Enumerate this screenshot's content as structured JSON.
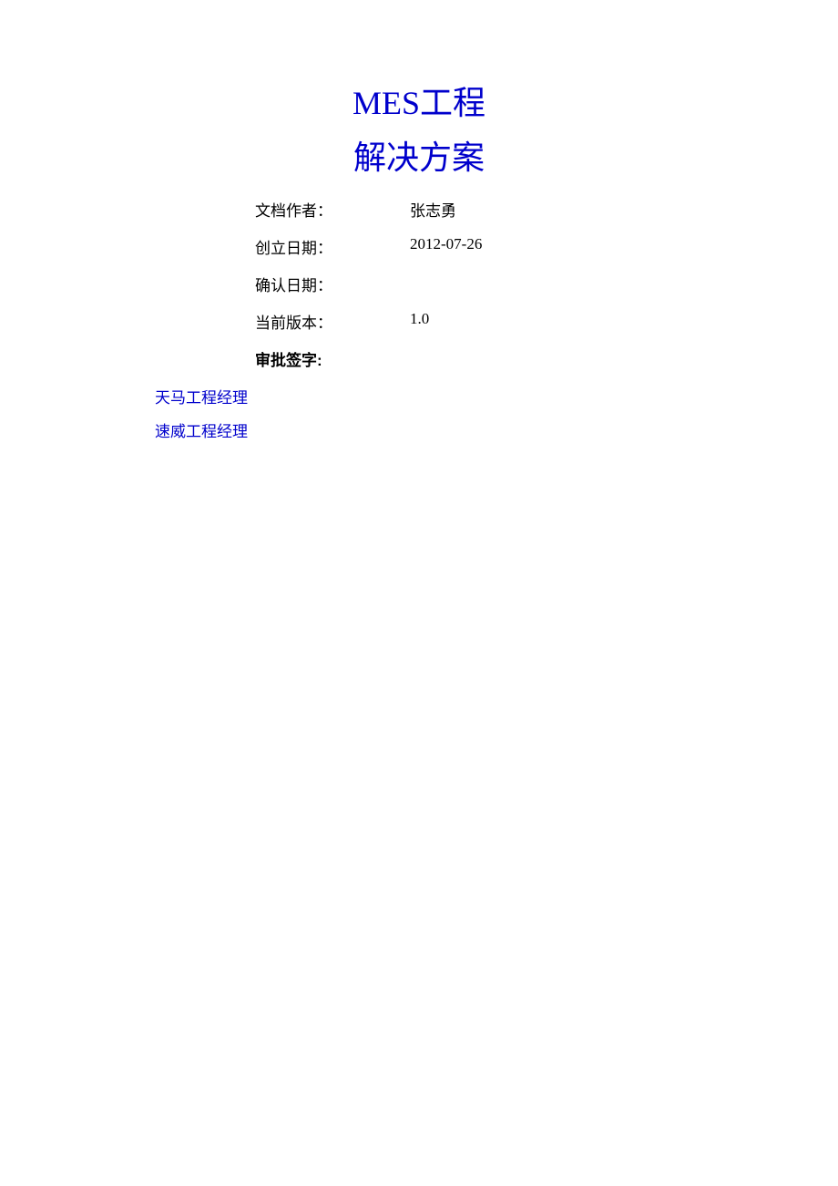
{
  "title": {
    "line1": "MES工程",
    "line2": "解决方案"
  },
  "info": {
    "author_label": "文档作者：",
    "author_value": "张志勇",
    "created_label": "创立日期：",
    "created_value": "2012-07-26",
    "confirmed_label": "确认日期：",
    "confirmed_value": "",
    "version_label": "当前版本：",
    "version_value": "1.0",
    "approval_label": "审批签字:"
  },
  "managers": {
    "tianma": "天马工程经理",
    "suwei": "速威工程经理"
  }
}
